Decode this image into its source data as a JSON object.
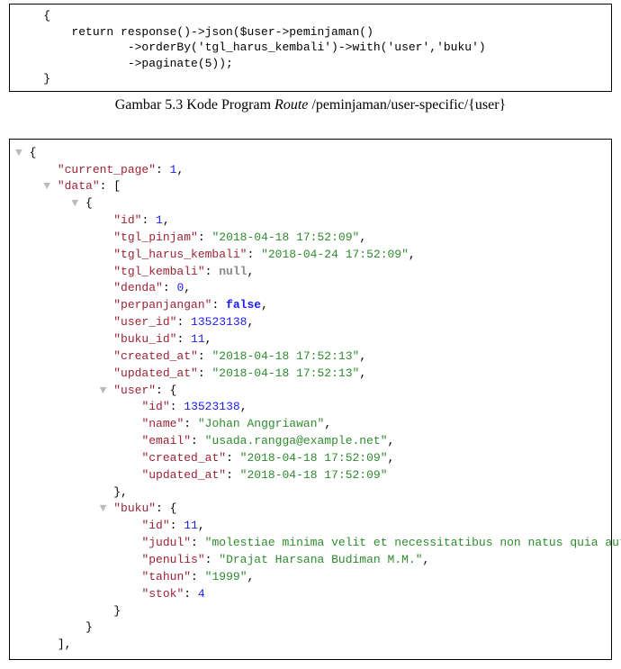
{
  "code_box": {
    "lines": [
      "    {",
      "        return response()->json($user->peminjaman()",
      "                ->orderBy('tgl_harus_kembali')->with('user','buku')",
      "                ->paginate(5));",
      "    }"
    ]
  },
  "caption": {
    "prefix": "Gambar 5.3 Kode Program ",
    "italic": "Route",
    "suffix": " /peminjaman/user-specific/{user}"
  },
  "json_tree": {
    "current_page": 1,
    "data_open_label": "\"data\"",
    "item": {
      "id": 1,
      "tgl_pinjam": "2018-04-18 17:52:09",
      "tgl_harus_kembali": "2018-04-24 17:52:09",
      "tgl_kembali": "null",
      "denda": 0,
      "perpanjangan": "false",
      "user_id": 13523138,
      "buku_id": 11,
      "created_at": "2018-04-18 17:52:13",
      "updated_at": "2018-04-18 17:52:13",
      "user": {
        "id": 13523138,
        "name": "Johan Anggriawan",
        "email": "usada.rangga@example.net",
        "created_at": "2018-04-18 17:52:09",
        "updated_at": "2018-04-18 17:52:09"
      },
      "buku": {
        "id": 11,
        "judul": "molestiae minima velit et necessitatibus non natus quia aut qui",
        "penulis": "Drajat Harsana Budiman M.M.",
        "tahun": "1999",
        "stok": 4
      }
    }
  }
}
